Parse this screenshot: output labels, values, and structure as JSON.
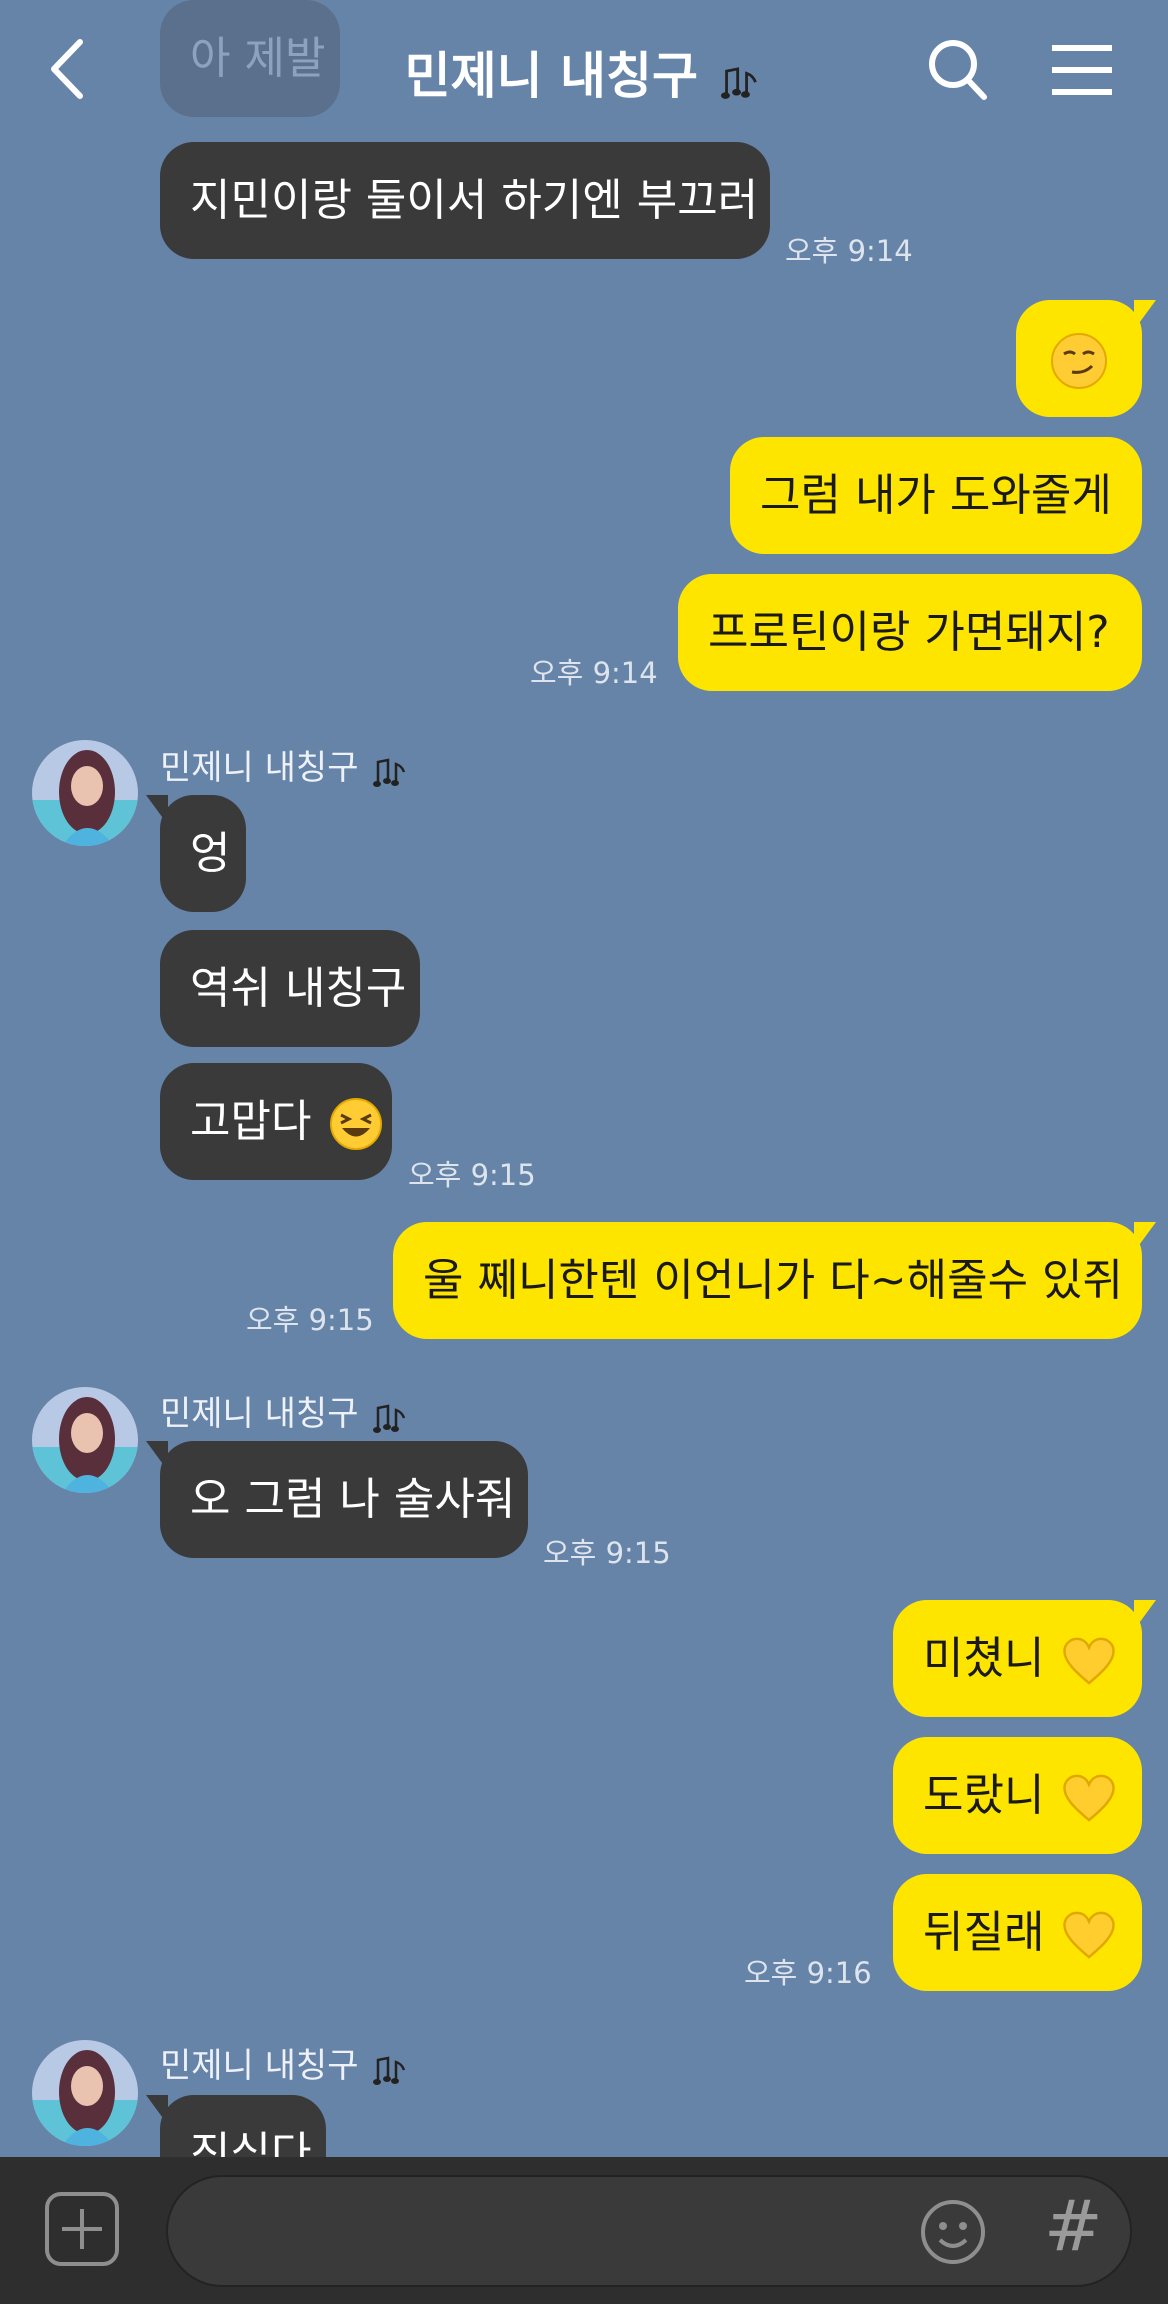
{
  "header": {
    "title": "민제니 내칭구",
    "title_icon": "music-notes-icon"
  },
  "partial_top_message": "아 제발",
  "messages": [
    {
      "text": "지민이랑 둘이서 하기엔 부끄러",
      "time": "오후 9:14"
    },
    {
      "text": "",
      "emoji": "smirk-emoji"
    },
    {
      "text": "그럼 내가 도와줄게"
    },
    {
      "text": "프로틴이랑 가면돼지?",
      "time": "오후 9:14"
    },
    {
      "sender": "민제니 내칭구",
      "text": "엉"
    },
    {
      "text": "역쉬 내칭구"
    },
    {
      "text": "고맙다",
      "emoji": "laughing-emoji",
      "time": "오후 9:15"
    },
    {
      "text": "울 쩨니한텐 이언니가 다~해줄수 있쥐",
      "time": "오후 9:15"
    },
    {
      "sender": "민제니 내칭구",
      "text": "오 그럼 나 술사줘",
      "time": "오후 9:15"
    },
    {
      "text": "미쳤니",
      "emoji": "yellow-heart-emoji"
    },
    {
      "text": "도랐니",
      "emoji": "yellow-heart-emoji"
    },
    {
      "text": "뒤질래",
      "emoji": "yellow-heart-emoji",
      "time": "오후 9:16"
    },
    {
      "sender": "민제니 내칭구",
      "text": "진심다"
    }
  ],
  "colors": {
    "background": "#6683a8",
    "my_bubble": "#fee500",
    "their_bubble": "#3a3a3a",
    "input_bar": "#2e2e2e"
  },
  "input_bar": {
    "plus_icon": "plus-icon",
    "emoji_icon": "emoji-icon",
    "hash_label": "#"
  }
}
